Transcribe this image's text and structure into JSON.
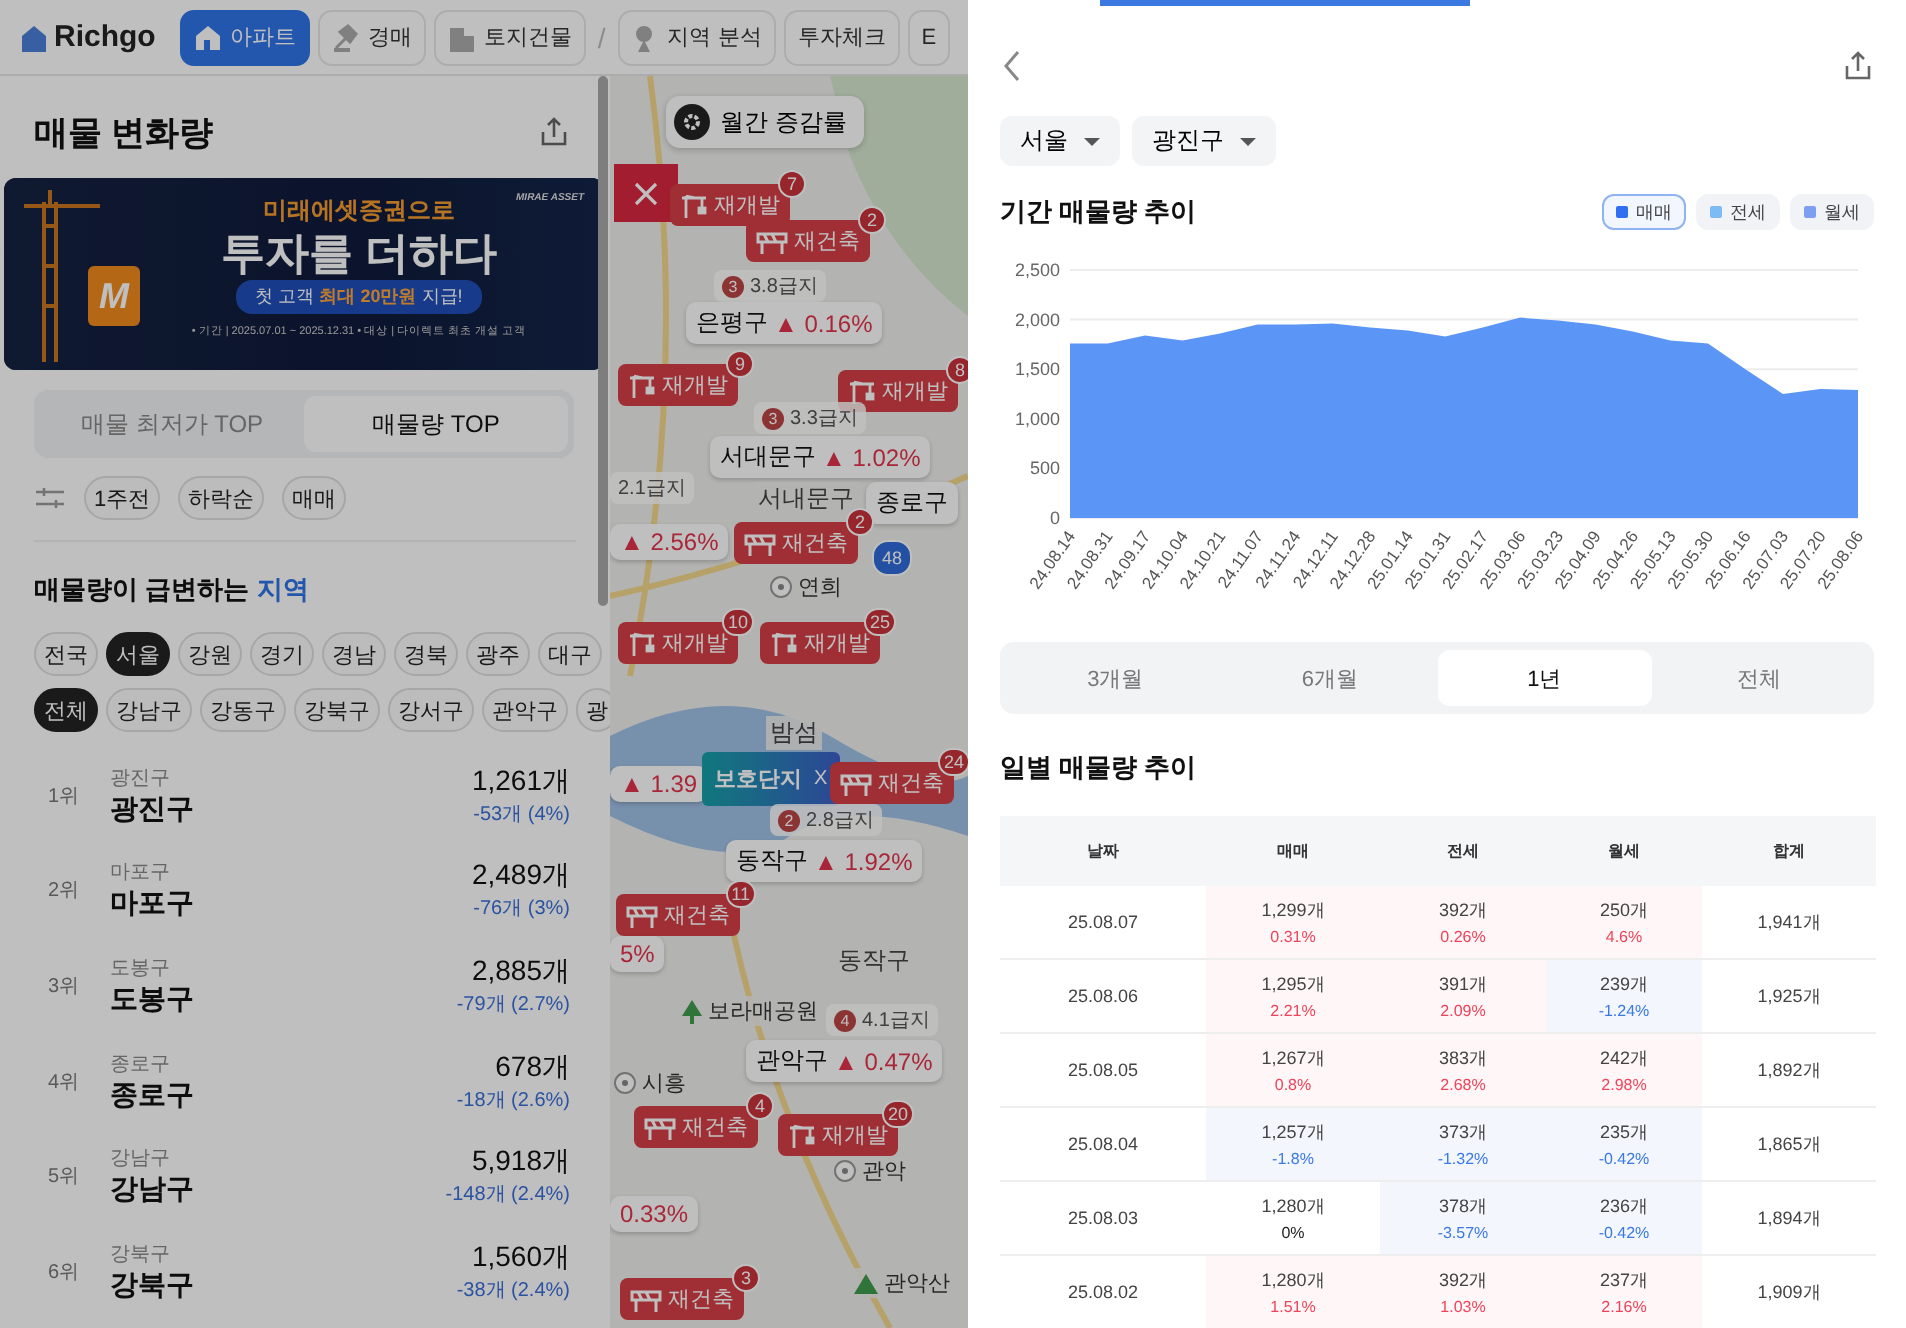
{
  "nav": {
    "logo": "Richgo",
    "items": [
      {
        "kind": "tab",
        "label": "아파트",
        "selected": true
      },
      {
        "kind": "tab",
        "label": "경매",
        "selected": false
      },
      {
        "kind": "tab",
        "label": "토지건물",
        "selected": false
      },
      {
        "kind": "separator",
        "label": "/"
      },
      {
        "kind": "tab",
        "label": "지역 분석",
        "selected": false
      },
      {
        "kind": "tab",
        "label": "투자체크",
        "selected": false
      },
      {
        "kind": "tab",
        "label": "E",
        "selected": false
      }
    ]
  },
  "panel": {
    "title": "매물 변화량",
    "banner": {
      "brand": "MIRAE ASSET",
      "logo": "M",
      "headline": "미래에셋증권으로",
      "title": "투자를 더하다",
      "offer": "첫 고객 **최대 20만원** 지급!",
      "terms": "• 기간 | 2025.07.01 ~ 2025.12.31   • 대상 | 다이렉트 최초 개설 고객"
    },
    "segments": [
      {
        "label": "매물 최저가 TOP",
        "selected": false
      },
      {
        "label": "매물량 TOP",
        "selected": true
      }
    ],
    "filters": [
      "1주전",
      "하락순",
      "매매"
    ],
    "heading": "매물량이 급변하는",
    "heading_link": "지역",
    "regions": [
      {
        "label": "전국",
        "selected": false
      },
      {
        "label": "서울",
        "selected": true
      },
      {
        "label": "강원",
        "selected": false
      },
      {
        "label": "경기",
        "selected": false
      },
      {
        "label": "경남",
        "selected": false
      },
      {
        "label": "경북",
        "selected": false
      },
      {
        "label": "광주",
        "selected": false
      },
      {
        "label": "대구",
        "selected": false
      }
    ],
    "districts": [
      {
        "label": "전체",
        "selected": true
      },
      {
        "label": "강남구",
        "selected": false
      },
      {
        "label": "강동구",
        "selected": false
      },
      {
        "label": "강북구",
        "selected": false
      },
      {
        "label": "강서구",
        "selected": false
      },
      {
        "label": "관악구",
        "selected": false
      },
      {
        "label": "광",
        "selected": false
      }
    ],
    "ranking": [
      {
        "rank": "1위",
        "region": "광진구",
        "name": "광진구",
        "count": "1,261개",
        "change": "-53개 (4%)"
      },
      {
        "rank": "2위",
        "region": "마포구",
        "name": "마포구",
        "count": "2,489개",
        "change": "-76개 (3%)"
      },
      {
        "rank": "3위",
        "region": "도봉구",
        "name": "도봉구",
        "count": "2,885개",
        "change": "-79개 (2.7%)"
      },
      {
        "rank": "4위",
        "region": "종로구",
        "name": "종로구",
        "count": "678개",
        "change": "-18개 (2.6%)"
      },
      {
        "rank": "5위",
        "region": "강남구",
        "name": "강남구",
        "count": "5,918개",
        "change": "-148개 (2.4%)"
      },
      {
        "rank": "6위",
        "region": "강북구",
        "name": "강북구",
        "count": "1,560개",
        "change": "-38개 (2.4%)"
      }
    ]
  },
  "map": {
    "monthly_button": "월간 증감률",
    "markers": [
      {
        "kind": "redevelop",
        "label": "재개발",
        "count": "7"
      },
      {
        "kind": "rebuild",
        "label": "재건축",
        "count": "2"
      },
      {
        "kind": "grade",
        "number": "3",
        "label": "3.8급지"
      },
      {
        "kind": "district",
        "name": "은평구",
        "change": "▲ 0.16%"
      },
      {
        "kind": "redevelop",
        "label": "재개발",
        "count": "9"
      },
      {
        "kind": "redevelop",
        "label": "재개발",
        "count": "8"
      },
      {
        "kind": "grade",
        "number": "3",
        "label": "3.3급지"
      },
      {
        "kind": "district",
        "name": "서대문구",
        "change": "▲ 1.02%"
      },
      {
        "kind": "grade",
        "label": "2.1급지"
      },
      {
        "kind": "place",
        "label": "서내문구"
      },
      {
        "kind": "district",
        "name": "종로구"
      },
      {
        "kind": "district",
        "change": "▲ 2.56%"
      },
      {
        "kind": "rebuild",
        "label": "재건축",
        "count": "2"
      },
      {
        "kind": "road",
        "label": "48"
      },
      {
        "kind": "ic",
        "label": "연희"
      },
      {
        "kind": "redevelop",
        "label": "재개발",
        "count": "10"
      },
      {
        "kind": "redevelop",
        "label": "재개발",
        "count": "25"
      },
      {
        "kind": "place",
        "label": "밤섬"
      },
      {
        "kind": "district",
        "change": "▲ 1.39"
      },
      {
        "kind": "tooltip",
        "label": "보호단지",
        "close": "X"
      },
      {
        "kind": "rebuild",
        "label": "재건축",
        "count": "24"
      },
      {
        "kind": "grade",
        "number": "2",
        "label": "2.8급지"
      },
      {
        "kind": "district",
        "name": "동작구",
        "change": "▲ 1.92%"
      },
      {
        "kind": "rebuild",
        "label": "재건축",
        "count": "11"
      },
      {
        "kind": "district",
        "change": "5%"
      },
      {
        "kind": "place",
        "label": "동작구"
      },
      {
        "kind": "park",
        "label": "보라매공원"
      },
      {
        "kind": "grade",
        "number": "4",
        "label": "4.1급지"
      },
      {
        "kind": "district",
        "name": "관악구",
        "change": "▲ 0.47%"
      },
      {
        "kind": "ic",
        "label": "시흥"
      },
      {
        "kind": "rebuild",
        "label": "재건축",
        "count": "4"
      },
      {
        "kind": "redevelop",
        "label": "재개발",
        "count": "20"
      },
      {
        "kind": "ic",
        "label": "관악"
      },
      {
        "kind": "district",
        "change": "0.33%"
      },
      {
        "kind": "rebuild",
        "label": "재건축",
        "count": "3"
      },
      {
        "kind": "mountain",
        "label": "관악산"
      }
    ]
  },
  "sheet": {
    "selects": [
      {
        "value": "서울"
      },
      {
        "value": "광진구"
      }
    ],
    "trend_title": "기간 매물량 추이",
    "legend": [
      {
        "label": "매매",
        "color": "#2f6ff0",
        "selected": true
      },
      {
        "label": "전세",
        "color": "#7cbcf6",
        "selected": false
      },
      {
        "label": "월세",
        "color": "#7d9ff2",
        "selected": false
      }
    ],
    "chart_data": {
      "type": "area",
      "categories": [
        "24.08.14",
        "24.08.31",
        "24.09.17",
        "24.10.04",
        "24.10.21",
        "24.11.07",
        "24.11.24",
        "24.12.11",
        "24.12.28",
        "25.01.14",
        "25.01.31",
        "25.02.17",
        "25.03.06",
        "25.03.23",
        "25.04.09",
        "25.04.26",
        "25.05.13",
        "25.05.30",
        "25.06.16",
        "25.07.03",
        "25.07.20",
        "25.08.06"
      ],
      "series": [
        {
          "color": "#5b96f7",
          "values": [
            1760,
            1760,
            1840,
            1790,
            1860,
            1950,
            1950,
            1960,
            1920,
            1890,
            1830,
            1920,
            2020,
            1990,
            1950,
            1880,
            1790,
            1760,
            1500,
            1250,
            1300,
            1290
          ]
        }
      ],
      "ylim": [
        0,
        2500
      ],
      "yticks": [
        {
          "value": 0,
          "label": "0"
        },
        {
          "value": 500,
          "label": "500"
        },
        {
          "value": 1000,
          "label": "1,000"
        },
        {
          "value": 1500,
          "label": "1,500"
        },
        {
          "value": 2000,
          "label": "2,000"
        },
        {
          "value": 2500,
          "label": "2,500"
        }
      ]
    },
    "periods": [
      {
        "label": "3개월",
        "selected": false
      },
      {
        "label": "6개월",
        "selected": false
      },
      {
        "label": "1년",
        "selected": true
      },
      {
        "label": "전체",
        "selected": false
      }
    ],
    "daily_title": "일별 매물량 추이",
    "table": {
      "columns": [
        "날짜",
        "매매",
        "전세",
        "월세",
        "합계"
      ],
      "rows": [
        {
          "cells": [
            {
              "kind": "date",
              "text": "25.08.07"
            },
            {
              "kind": "change",
              "count": "1,299개",
              "change": "0.31%",
              "increase": true,
              "decrease": false
            },
            {
              "kind": "change",
              "count": "392개",
              "change": "0.26%",
              "increase": true,
              "decrease": false
            },
            {
              "kind": "change",
              "count": "250개",
              "change": "4.6%",
              "increase": true,
              "decrease": false
            },
            {
              "kind": "total",
              "text": "1,941개"
            }
          ]
        },
        {
          "cells": [
            {
              "kind": "date",
              "text": "25.08.06"
            },
            {
              "kind": "change",
              "count": "1,295개",
              "change": "2.21%",
              "increase": true,
              "decrease": false
            },
            {
              "kind": "change",
              "count": "391개",
              "change": "2.09%",
              "increase": true,
              "decrease": false
            },
            {
              "kind": "change",
              "count": "239개",
              "change": "-1.24%",
              "increase": false,
              "decrease": true
            },
            {
              "kind": "total",
              "text": "1,925개"
            }
          ]
        },
        {
          "cells": [
            {
              "kind": "date",
              "text": "25.08.05"
            },
            {
              "kind": "change",
              "count": "1,267개",
              "change": "0.8%",
              "increase": true,
              "decrease": false
            },
            {
              "kind": "change",
              "count": "383개",
              "change": "2.68%",
              "increase": true,
              "decrease": false
            },
            {
              "kind": "change",
              "count": "242개",
              "change": "2.98%",
              "increase": true,
              "decrease": false
            },
            {
              "kind": "total",
              "text": "1,892개"
            }
          ]
        },
        {
          "cells": [
            {
              "kind": "date",
              "text": "25.08.04"
            },
            {
              "kind": "change",
              "count": "1,257개",
              "change": "-1.8%",
              "increase": false,
              "decrease": true
            },
            {
              "kind": "change",
              "count": "373개",
              "change": "-1.32%",
              "increase": false,
              "decrease": true
            },
            {
              "kind": "change",
              "count": "235개",
              "change": "-0.42%",
              "increase": false,
              "decrease": true
            },
            {
              "kind": "total",
              "text": "1,865개"
            }
          ]
        },
        {
          "cells": [
            {
              "kind": "date",
              "text": "25.08.03"
            },
            {
              "kind": "change",
              "count": "1,280개",
              "change": "0%",
              "increase": false,
              "decrease": false
            },
            {
              "kind": "change",
              "count": "378개",
              "change": "-3.57%",
              "increase": false,
              "decrease": true
            },
            {
              "kind": "change",
              "count": "236개",
              "change": "-0.42%",
              "increase": false,
              "decrease": true
            },
            {
              "kind": "total",
              "text": "1,894개"
            }
          ]
        },
        {
          "cells": [
            {
              "kind": "date",
              "text": "25.08.02"
            },
            {
              "kind": "change",
              "count": "1,280개",
              "change": "1.51%",
              "increase": true,
              "decrease": false
            },
            {
              "kind": "change",
              "count": "392개",
              "change": "1.03%",
              "increase": true,
              "decrease": false
            },
            {
              "kind": "change",
              "count": "237개",
              "change": "2.16%",
              "increase": true,
              "decrease": false
            },
            {
              "kind": "total",
              "text": "1,909개"
            }
          ]
        }
      ]
    }
  }
}
